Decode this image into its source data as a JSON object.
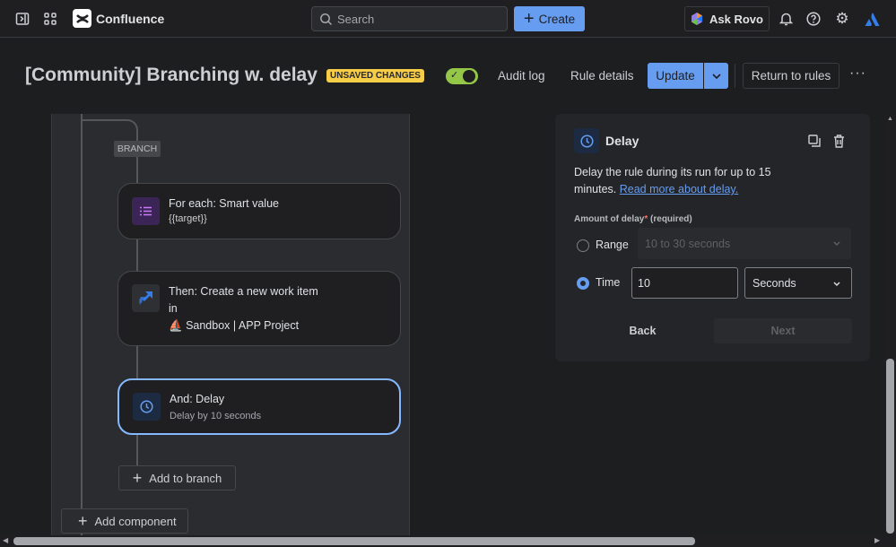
{
  "topbar": {
    "app_name": "Confluence",
    "search_placeholder": "Search",
    "create_label": "Create",
    "ask_rovo_label": "Ask Rovo"
  },
  "header": {
    "title": "[Community] Branching w. delay",
    "badge": "UNSAVED CHANGES",
    "toggle_on": true,
    "audit_log": "Audit log",
    "rule_details": "Rule details",
    "update": "Update",
    "return_to_rules": "Return to rules"
  },
  "canvas": {
    "branch_label": "BRANCH",
    "nodes": [
      {
        "title": "For each: Smart value",
        "subtitle": "{{target}}",
        "icon": "list-icon"
      },
      {
        "title": "Then: Create a new work item",
        "title2": "in",
        "subtitle": "Sandbox | APP Project",
        "icon": "jira-icon"
      },
      {
        "title": "And: Delay",
        "subtitle": "Delay by 10 seconds",
        "icon": "clock-icon",
        "selected": true
      }
    ],
    "add_to_branch": "Add to branch",
    "add_component": "Add component"
  },
  "panel": {
    "title": "Delay",
    "description": "Delay the rule during its run for up to 15 minutes.",
    "link": "Read more about delay.",
    "field_label": "Amount of delay",
    "required_mark": "*",
    "required_text": "(required)",
    "range_label": "Range",
    "range_value": "10 to 30 seconds",
    "time_label": "Time",
    "time_value": "10",
    "unit_value": "Seconds",
    "selected_option": "Time",
    "back": "Back",
    "next": "Next"
  },
  "colors": {
    "accent": "#669df1",
    "badge": "#f5cd47",
    "toggle": "#94c748",
    "link": "#669df1",
    "required": "#f87168"
  }
}
